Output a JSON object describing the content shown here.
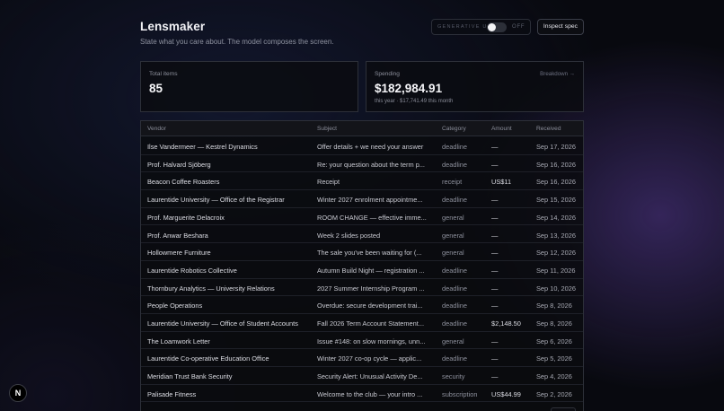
{
  "app": {
    "title": "Lensmaker",
    "subtitle": "State what you care about. The model composes the screen."
  },
  "toggle": {
    "label": "GENERATIVE UI",
    "state": "OFF"
  },
  "inspect_button": "Inspect spec",
  "cards": {
    "total": {
      "label": "Total items",
      "value": "85"
    },
    "spending": {
      "label": "Spending",
      "value": "$182,984.91",
      "sub": "this year · $17,741.49 this month",
      "link": "Breakdown →"
    }
  },
  "table": {
    "headers": [
      "Vendor",
      "Subject",
      "Category",
      "Amount",
      "Received"
    ],
    "rows": [
      {
        "vendor": "Ilse Vandermeer — Kestrel Dynamics",
        "subject": "Offer details + we need your answer",
        "category": "deadline",
        "amount": "—",
        "received": "Sep 17, 2026"
      },
      {
        "vendor": "Prof. Halvard Sjöberg",
        "subject": "Re: your question about the term p...",
        "category": "deadline",
        "amount": "—",
        "received": "Sep 16, 2026"
      },
      {
        "vendor": "Beacon Coffee Roasters",
        "subject": "Receipt",
        "category": "receipt",
        "amount": "US$11",
        "received": "Sep 16, 2026"
      },
      {
        "vendor": "Laurentide University — Office of the Registrar",
        "subject": "Winter 2027 enrolment appointme...",
        "category": "deadline",
        "amount": "—",
        "received": "Sep 15, 2026"
      },
      {
        "vendor": "Prof. Marguerite Delacroix",
        "subject": "ROOM CHANGE — effective imme...",
        "category": "general",
        "amount": "—",
        "received": "Sep 14, 2026"
      },
      {
        "vendor": "Prof. Anwar Beshara",
        "subject": "Week 2 slides posted",
        "category": "general",
        "amount": "—",
        "received": "Sep 13, 2026"
      },
      {
        "vendor": "Hollowmere Furniture",
        "subject": "The sale you've been waiting for (...",
        "category": "general",
        "amount": "—",
        "received": "Sep 12, 2026"
      },
      {
        "vendor": "Laurentide Robotics Collective",
        "subject": "Autumn Build Night — registration ...",
        "category": "deadline",
        "amount": "—",
        "received": "Sep 11, 2026"
      },
      {
        "vendor": "Thornbury Analytics — University Relations",
        "subject": "2027 Summer Internship Program ...",
        "category": "deadline",
        "amount": "—",
        "received": "Sep 10, 2026"
      },
      {
        "vendor": "People Operations",
        "subject": "Overdue: secure development trai...",
        "category": "deadline",
        "amount": "—",
        "received": "Sep 8, 2026"
      },
      {
        "vendor": "Laurentide University — Office of Student Accounts",
        "subject": "Fall 2026 Term Account Statement...",
        "category": "deadline",
        "amount": "$2,148.50",
        "received": "Sep 8, 2026"
      },
      {
        "vendor": "The Loamwork Letter",
        "subject": "Issue #148: on slow mornings, unn...",
        "category": "general",
        "amount": "—",
        "received": "Sep 6, 2026"
      },
      {
        "vendor": "Laurentide Co-operative Education Office",
        "subject": "Winter 2027 co-op cycle — applic...",
        "category": "deadline",
        "amount": "—",
        "received": "Sep 5, 2026"
      },
      {
        "vendor": "Meridian Trust Bank Security",
        "subject": "Security Alert: Unusual Activity De...",
        "category": "security",
        "amount": "—",
        "received": "Sep 4, 2026"
      },
      {
        "vendor": "Palisade Fitness",
        "subject": "Welcome to the club — your intro ...",
        "category": "subscription",
        "amount": "US$44.99",
        "received": "Sep 2, 2026"
      }
    ]
  },
  "badge": "N",
  "icons": {
    "next_badge": "nextjs-logo-icon",
    "toggle": "toggle-switch-icon"
  }
}
